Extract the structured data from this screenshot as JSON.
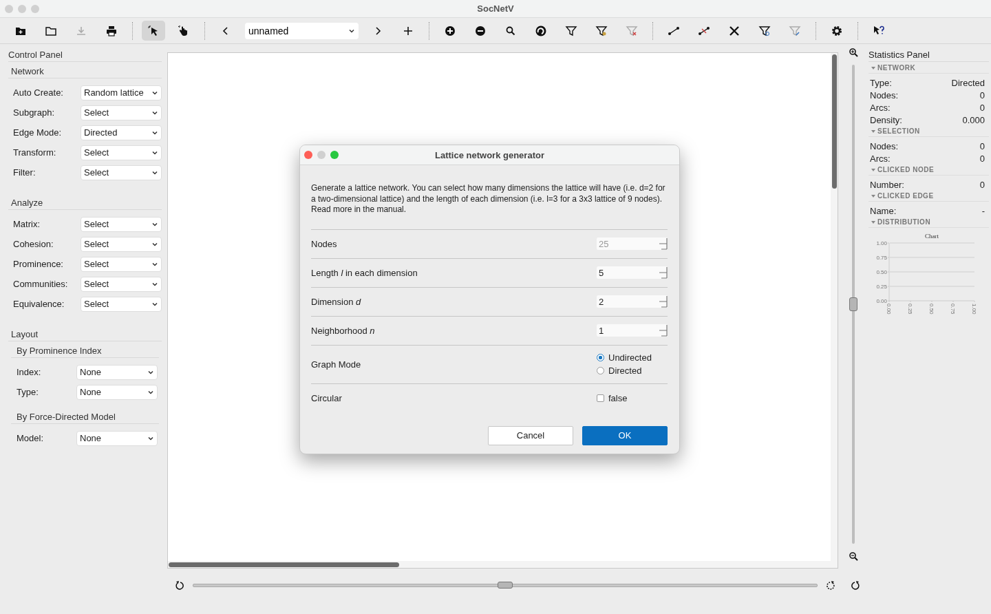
{
  "window": {
    "title": "SocNetV"
  },
  "toolbar": [
    {
      "kind": "button",
      "disabled": false
    },
    {
      "kind": "button",
      "disabled": false
    },
    {
      "kind": "button",
      "disabled": true
    },
    {
      "kind": "button",
      "disabled": false
    },
    {
      "kind": "separator"
    },
    {
      "kind": "tool",
      "selected": true
    },
    {
      "kind": "tool",
      "selected": false
    },
    {
      "kind": "separator"
    },
    {
      "kind": "button",
      "disabled": false
    },
    {
      "kind": "combo",
      "value": "unnamed"
    },
    {
      "kind": "button",
      "disabled": false
    },
    {
      "kind": "button",
      "disabled": false
    },
    {
      "kind": "separator"
    },
    {
      "kind": "button",
      "disabled": false
    },
    {
      "kind": "button",
      "disabled": false
    },
    {
      "kind": "button",
      "disabled": false
    },
    {
      "kind": "button",
      "disabled": false
    },
    {
      "kind": "button",
      "disabled": false
    },
    {
      "kind": "button",
      "disabled": false
    },
    {
      "kind": "button",
      "disabled": true
    },
    {
      "kind": "separator"
    },
    {
      "kind": "button",
      "disabled": false
    },
    {
      "kind": "button",
      "disabled": false
    },
    {
      "kind": "button",
      "disabled": false
    },
    {
      "kind": "button",
      "disabled": false
    },
    {
      "kind": "button",
      "disabled": true
    },
    {
      "kind": "separator"
    },
    {
      "kind": "button",
      "disabled": false
    },
    {
      "kind": "separator"
    },
    {
      "kind": "button",
      "disabled": false
    }
  ],
  "control_panel": {
    "title": "Control Panel",
    "sections": [
      {
        "title": "Network",
        "fields": [
          {
            "label": "Auto Create:",
            "value": "Random lattice"
          },
          {
            "label": "Subgraph:",
            "value": "Select"
          },
          {
            "label": "Edge Mode:",
            "value": "Directed"
          },
          {
            "label": "Transform:",
            "value": "Select"
          },
          {
            "label": "Filter:",
            "value": "Select"
          }
        ]
      },
      {
        "title": "Analyze",
        "fields": [
          {
            "label": "Matrix:",
            "value": "Select"
          },
          {
            "label": "Cohesion:",
            "value": "Select"
          },
          {
            "label": "Prominence:",
            "value": "Select"
          },
          {
            "label": "Communities:",
            "value": "Select"
          },
          {
            "label": "Equivalence:",
            "value": "Select"
          }
        ]
      },
      {
        "title": "Layout",
        "subsections": [
          {
            "title": "By Prominence Index",
            "fields": [
              {
                "label": "Index:",
                "value": "None"
              },
              {
                "label": "Type:",
                "value": "None"
              }
            ]
          },
          {
            "title": "By Force-Directed Model",
            "fields": [
              {
                "label": "Model:",
                "value": "None"
              }
            ]
          }
        ]
      }
    ]
  },
  "zoom_slider": {
    "level": 0.5
  },
  "rotate_slider": {
    "level": 0.5
  },
  "dialog": {
    "title": "Lattice network generator",
    "description": "Generate a lattice network. You can select how many dimensions the lattice will have (i.e. d=2 for a two-dimensional lattice) and the length of each dimension (i.e. l=3 for a 3x3 lattice of 9 nodes). Read more in the manual.",
    "rows": [
      {
        "kind": "spin",
        "label": "Nodes",
        "value": "25",
        "disabled": true
      },
      {
        "kind": "spin",
        "label": "Length *l* in each dimension",
        "value": "5",
        "disabled": false
      },
      {
        "kind": "spin",
        "label": "Dimension *d*",
        "value": "2",
        "disabled": false
      },
      {
        "kind": "spin",
        "label": "Neighborhood *n*",
        "value": "1",
        "disabled": false
      },
      {
        "kind": "radio",
        "label": "Graph Mode",
        "options": [
          {
            "label": "Undirected",
            "selected": true
          },
          {
            "label": "Directed",
            "selected": false
          }
        ]
      },
      {
        "kind": "checkbox",
        "label": "Circular",
        "checked": false,
        "text": "false"
      }
    ],
    "buttons": [
      {
        "label": "Cancel",
        "primary": false
      },
      {
        "label": "OK",
        "primary": true
      }
    ]
  },
  "statistics_panel": {
    "title": "Statistics Panel",
    "sections": [
      {
        "title": "NETWORK",
        "rows": [
          {
            "label": "Type:",
            "value": "Directed"
          },
          {
            "label": "Nodes:",
            "value": "0"
          },
          {
            "label": "Arcs:",
            "value": "0"
          },
          {
            "label": "Density:",
            "value": "0.000"
          }
        ]
      },
      {
        "title": "SELECTION",
        "rows": [
          {
            "label": "Nodes:",
            "value": "0"
          },
          {
            "label": "Arcs:",
            "value": "0"
          }
        ]
      },
      {
        "title": "CLICKED NODE",
        "rows": [
          {
            "label": "Number:",
            "value": "0"
          }
        ]
      },
      {
        "title": "CLICKED EDGE",
        "rows": [
          {
            "label": "Name:",
            "value": "-"
          }
        ]
      },
      {
        "title": "DISTRIBUTION",
        "chart_data": {
          "type": "line",
          "title": "Chart",
          "grid": true,
          "xlim": [
            0,
            1
          ],
          "ylim": [
            0,
            1
          ],
          "xticks": [
            {
              "value": 0,
              "label": "0.00"
            },
            {
              "value": 0.25,
              "label": "0.25"
            },
            {
              "value": 0.5,
              "label": "0.50"
            },
            {
              "value": 0.75,
              "label": "0.75"
            },
            {
              "value": 1,
              "label": "1.00"
            }
          ],
          "yticks": [
            {
              "value": 0,
              "label": "0.00"
            },
            {
              "value": 0.25,
              "label": "0.25"
            },
            {
              "value": 0.5,
              "label": "0.50"
            },
            {
              "value": 0.75,
              "label": "0.75"
            },
            {
              "value": 1,
              "label": "1.00"
            }
          ]
        }
      }
    ]
  }
}
